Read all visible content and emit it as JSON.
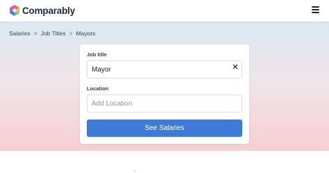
{
  "header": {
    "brand_name": "Comparably",
    "logo_icon": "comparably-logo-icon",
    "menu_icon": "hamburger-menu-icon"
  },
  "breadcrumb": {
    "items": [
      "Salaries",
      "Job Titles",
      "Mayors"
    ],
    "separator": ">"
  },
  "search_form": {
    "job_title_label": "Job title",
    "job_title_value": "Mayor",
    "clear_icon": "close-icon",
    "location_label": "Location",
    "location_placeholder": "Add Location",
    "submit_label": "See Salaries"
  },
  "colors": {
    "accent": "#3f7bd6",
    "hero_top": "#dbe9f2",
    "hero_bottom": "#f7cfd3"
  }
}
